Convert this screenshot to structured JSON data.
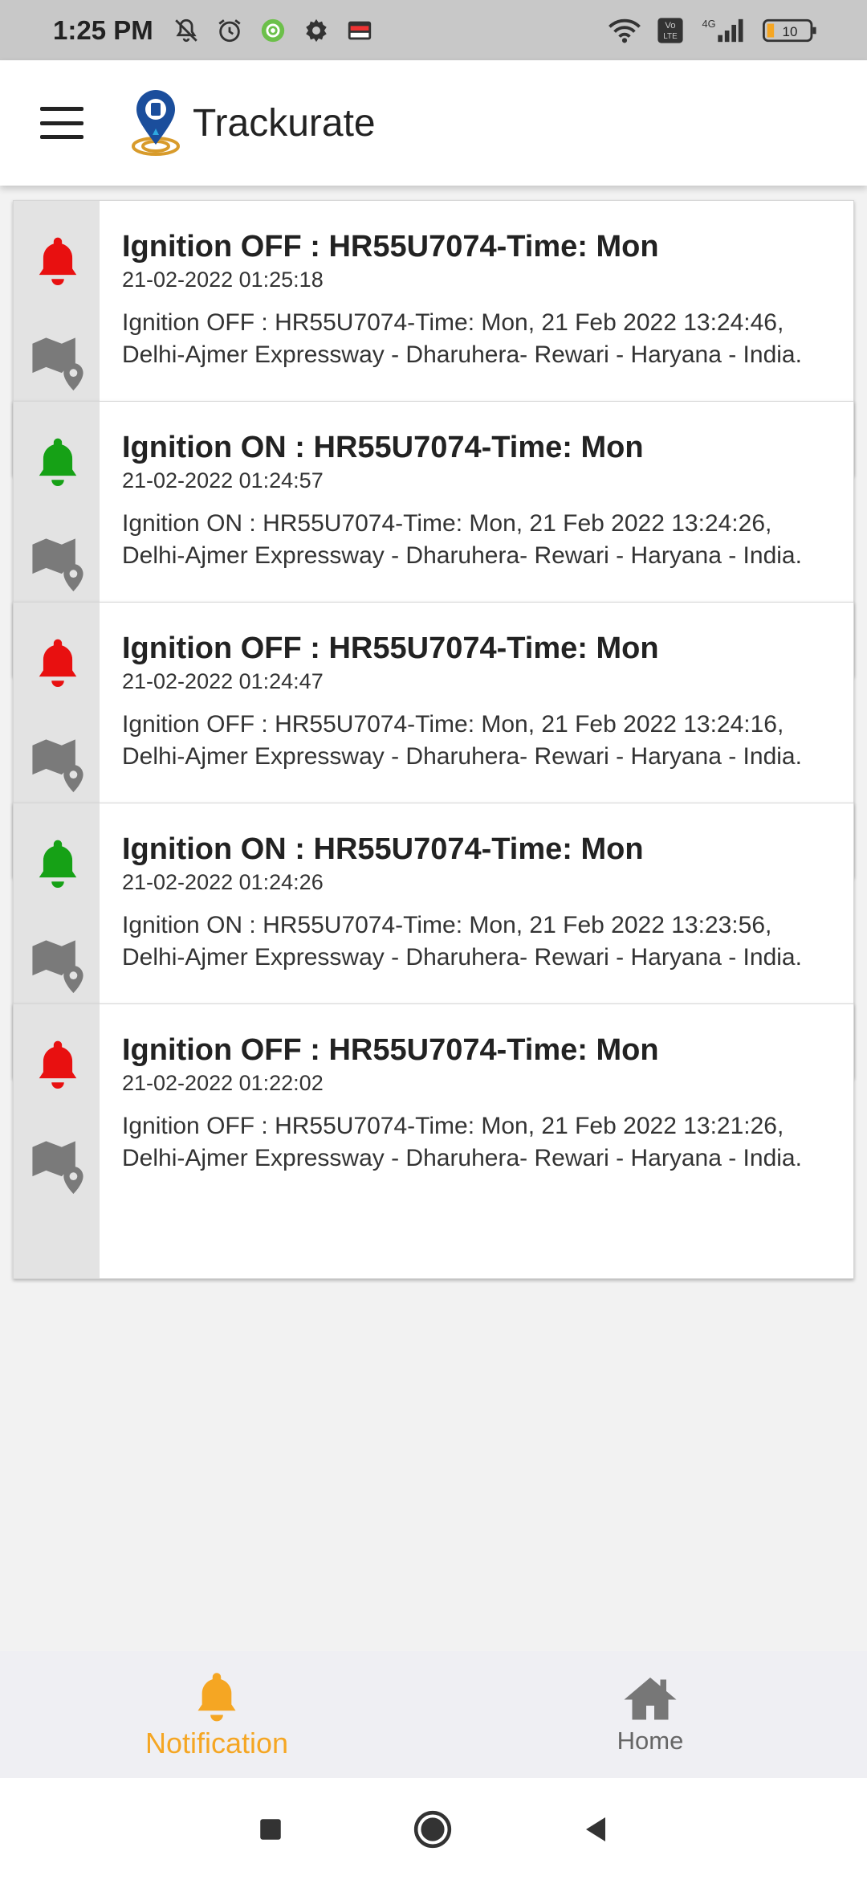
{
  "status_bar": {
    "time": "1:25 PM",
    "left_icons": [
      "bell-off-icon",
      "alarm-icon",
      "app-notification-icon",
      "settings-icon",
      "card-icon"
    ],
    "right_icons": [
      "wifi-icon",
      "volte-icon",
      "signal-4g-icon",
      "battery-icon"
    ],
    "volte_label": "Vo\nLTE",
    "network_label": "4G",
    "battery_level": "10"
  },
  "app_bar": {
    "title": "Trackurate",
    "menu_icon": "hamburger-menu-icon",
    "logo_icon": "location-pin-logo-icon"
  },
  "colors": {
    "alert_off": "#e81010",
    "alert_on": "#16a116",
    "accent": "#f5a623",
    "map_icon": "#7a7a7a"
  },
  "notifications": [
    {
      "status": "off",
      "title": "Ignition OFF : HR55U7074-Time: Mon",
      "time": "21-02-2022 01:25:18",
      "text": "Ignition OFF : HR55U7074-Time: Mon, 21 Feb 2022 13:24:46,\nDelhi-Ajmer Expressway - Dharuhera- Rewari - Haryana - India."
    },
    {
      "status": "on",
      "title": "Ignition ON : HR55U7074-Time: Mon",
      "time": "21-02-2022 01:24:57",
      "text": "Ignition ON : HR55U7074-Time: Mon, 21 Feb 2022 13:24:26,\nDelhi-Ajmer Expressway - Dharuhera- Rewari - Haryana - India."
    },
    {
      "status": "off",
      "title": "Ignition OFF : HR55U7074-Time: Mon",
      "time": "21-02-2022 01:24:47",
      "text": "Ignition OFF : HR55U7074-Time: Mon, 21 Feb 2022 13:24:16,\nDelhi-Ajmer Expressway - Dharuhera- Rewari - Haryana - India."
    },
    {
      "status": "on",
      "title": "Ignition ON : HR55U7074-Time: Mon",
      "time": "21-02-2022 01:24:26",
      "text": "Ignition ON : HR55U7074-Time: Mon, 21 Feb 2022 13:23:56,\nDelhi-Ajmer Expressway - Dharuhera- Rewari - Haryana - India."
    },
    {
      "status": "off",
      "title": "Ignition OFF : HR55U7074-Time: Mon",
      "time": "21-02-2022 01:22:02",
      "text": "Ignition OFF : HR55U7074-Time: Mon, 21 Feb 2022 13:21:26,\nDelhi-Ajmer Expressway - Dharuhera- Rewari - Haryana - India."
    }
  ],
  "bottom_nav": {
    "notification_label": "Notification",
    "home_label": "Home",
    "notification_icon": "bell-icon",
    "home_icon": "home-icon"
  },
  "system_nav": {
    "icons": [
      "recents-square-icon",
      "home-circle-icon",
      "back-triangle-icon"
    ]
  }
}
